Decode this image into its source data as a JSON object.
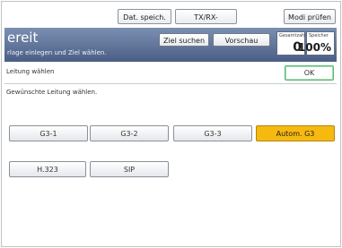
{
  "top_buttons": {
    "store": "Dat. speich.",
    "status": "TX/RX-Status/Druck",
    "mode": "Modi prüfen"
  },
  "status_band": {
    "title": "ereit",
    "subtitle": "rlage einlegen und Ziel wählen.",
    "search_label": "Ziel suchen",
    "preview_label": "Vorschau",
    "originals_label": "Gesamtzahl",
    "originals_value": "0",
    "scale_label": "Speicher",
    "scale_value": "100%"
  },
  "panel": {
    "title": "Leitung wählen",
    "ok_label": "OK",
    "hint": "Gewünschte Leitung wählen."
  },
  "lines": {
    "g3_1": "G3-1",
    "g3_2": "G3-2",
    "g3_3": "G3-3",
    "auto_g3": "Autom. G3",
    "h323": "H.323",
    "sip": "SIP",
    "selected": "Autom. G3"
  },
  "colors": {
    "selected_button": "#f6b910",
    "ok_border": "#59b66e",
    "band": "#5b6f96"
  }
}
